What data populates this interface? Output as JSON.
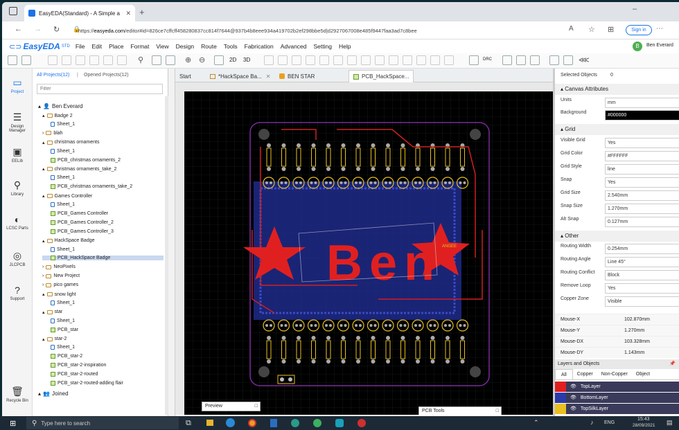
{
  "browser": {
    "tab_title": "EasyEDA(Standard) - A Simple a",
    "url_prefix": "https://",
    "url_host": "easyeda.com",
    "url_rest": "/editor#id=826ce7cffcff458280837cc814f7644@937b4b8eee934a419702b2ef298bbe5d|d2927067008e485f9447faa3ad7c8bee",
    "signin_label": "Sign in"
  },
  "app": {
    "logo": "EasyEDA",
    "logo_suffix": "STD",
    "menu": [
      "File",
      "Edit",
      "Place",
      "Format",
      "View",
      "Design",
      "Route",
      "Tools",
      "Fabrication",
      "Advanced",
      "Setting",
      "Help"
    ],
    "user_initial": "B",
    "user_name": "Ben Everard",
    "toolbar_2d": "2D",
    "toolbar_3d": "3D",
    "toolbar_drc": "DRC"
  },
  "rail": [
    {
      "label": "Project",
      "icon": "project-icon"
    },
    {
      "label": "Design Manager",
      "icon": "design-manager-icon"
    },
    {
      "label": "EELib",
      "icon": "eelib-icon"
    },
    {
      "label": "Library",
      "icon": "library-icon"
    },
    {
      "label": "LCSC Parts",
      "icon": "lcsc-icon"
    },
    {
      "label": "JLCPCB",
      "icon": "jlcpcb-icon"
    },
    {
      "label": "Support",
      "icon": "support-icon"
    },
    {
      "label": "Recycle Bin",
      "icon": "recycle-bin-icon"
    }
  ],
  "tree": {
    "tab_all": "All Projects(12)",
    "tab_sep": "|",
    "tab_opened": "Opened Projects(12)",
    "filter_placeholder": "Filter",
    "owner": "Ben Everard",
    "items": [
      {
        "label": "Badge 2",
        "type": "folder",
        "indent": 1,
        "expanded": true
      },
      {
        "label": "Sheet_1",
        "type": "sheet",
        "indent": 2
      },
      {
        "label": "blah",
        "type": "folder",
        "indent": 1
      },
      {
        "label": "christmas ornaments",
        "type": "folder",
        "indent": 1,
        "expanded": true
      },
      {
        "label": "Sheet_1",
        "type": "sheet",
        "indent": 2
      },
      {
        "label": "PCB_christmas ornaments_2",
        "type": "pcb",
        "indent": 2
      },
      {
        "label": "christmas ornaments_take_2",
        "type": "folder",
        "indent": 1,
        "expanded": true
      },
      {
        "label": "Sheet_1",
        "type": "sheet",
        "indent": 2
      },
      {
        "label": "PCB_christmas ornaments_take_2",
        "type": "pcb",
        "indent": 2
      },
      {
        "label": "Games Controller",
        "type": "folder",
        "indent": 1,
        "expanded": true
      },
      {
        "label": "Sheet_1",
        "type": "sheet",
        "indent": 2
      },
      {
        "label": "PCB_Games Controller",
        "type": "pcb",
        "indent": 2
      },
      {
        "label": "PCB_Games Controller_2",
        "type": "pcb",
        "indent": 2
      },
      {
        "label": "PCB_Games Controller_3",
        "type": "pcb",
        "indent": 2
      },
      {
        "label": "HackSpace Badge",
        "type": "folder",
        "indent": 1,
        "expanded": true
      },
      {
        "label": "Sheet_1",
        "type": "sheet",
        "indent": 2
      },
      {
        "label": "PCB_HackSpace Badge",
        "type": "pcb",
        "indent": 2,
        "selected": true
      },
      {
        "label": "NeoPixels",
        "type": "folder",
        "indent": 1
      },
      {
        "label": "New Project",
        "type": "folder",
        "indent": 1
      },
      {
        "label": "pico games",
        "type": "folder",
        "indent": 1
      },
      {
        "label": "snow light",
        "type": "folder",
        "indent": 1,
        "expanded": true
      },
      {
        "label": "Sheet_1",
        "type": "sheet",
        "indent": 2
      },
      {
        "label": "star",
        "type": "folder",
        "indent": 1,
        "expanded": true
      },
      {
        "label": "Sheet_1",
        "type": "sheet",
        "indent": 2
      },
      {
        "label": "PCB_star",
        "type": "pcb",
        "indent": 2
      },
      {
        "label": "star-2",
        "type": "folder",
        "indent": 1,
        "expanded": true
      },
      {
        "label": "Sheet_1",
        "type": "sheet",
        "indent": 2
      },
      {
        "label": "PCB_star-2",
        "type": "pcb",
        "indent": 2
      },
      {
        "label": "PCB_star-2-inspiration",
        "type": "pcb",
        "indent": 2
      },
      {
        "label": "PCB_star-2-routed",
        "type": "pcb",
        "indent": 2
      },
      {
        "label": "PCB_star-2-routed-adding flair",
        "type": "pcb",
        "indent": 2
      }
    ],
    "joined": "Joined"
  },
  "editor": {
    "tabs": [
      "Start",
      "*HackSpace Ba...",
      "BEN STAR",
      "PCB_HackSpace..."
    ],
    "board_text": "Ben",
    "preview_label": "Preview",
    "pcb_tools_label": "PCB Tools"
  },
  "rpanel": {
    "selected_objects_label": "Selected Objects",
    "selected_objects_count": "0",
    "canvas_section": "Canvas Attributes",
    "units_label": "Units",
    "units_value": "mm",
    "background_label": "Background",
    "background_value": "#000000",
    "grid_section": "Grid",
    "visible_grid_label": "Visible Grid",
    "visible_grid_value": "Yes",
    "grid_color_label": "Grid Color",
    "grid_color_value": "#FFFFFF",
    "grid_style_label": "Grid Style",
    "grid_style_value": "line",
    "snap_label": "Snap",
    "snap_value": "Yes",
    "grid_size_label": "Grid Size",
    "grid_size_value": "2.540mm",
    "snap_size_label": "Snap Size",
    "snap_size_value": "1.270mm",
    "alt_snap_label": "Alt Snap",
    "alt_snap_value": "0.127mm",
    "other_section": "Other",
    "routing_width_label": "Routing Width",
    "routing_width_value": "0.254mm",
    "routing_angle_label": "Routing Angle",
    "routing_angle_value": "Line 45°",
    "routing_conflict_label": "Routing Conflict",
    "routing_conflict_value": "Block",
    "remove_loop_label": "Remove Loop",
    "remove_loop_value": "Yes",
    "copper_zone_label": "Copper Zone",
    "copper_zone_value": "Visible",
    "mouse_x_label": "Mouse-X",
    "mouse_x_value": "102.870mm",
    "mouse_y_label": "Mouse-Y",
    "mouse_y_value": "1.270mm",
    "mouse_dx_label": "Mouse-DX",
    "mouse_dx_value": "103.328mm",
    "mouse_dy_label": "Mouse-DY",
    "mouse_dy_value": "1.143mm",
    "layers_title": "Layers and Objects",
    "layer_tabs": [
      "All",
      "Copper",
      "Non-Copper",
      "Object"
    ],
    "layers": [
      {
        "name": "TopLayer",
        "color": "#e02020"
      },
      {
        "name": "BottomLayer",
        "color": "#2a3aa8"
      },
      {
        "name": "TopSilkLayer",
        "color": "#e8c020"
      }
    ]
  },
  "taskbar": {
    "search_placeholder": "Type here to search",
    "lang": "ENG",
    "time": "15:43",
    "date": "28/09/2021"
  }
}
